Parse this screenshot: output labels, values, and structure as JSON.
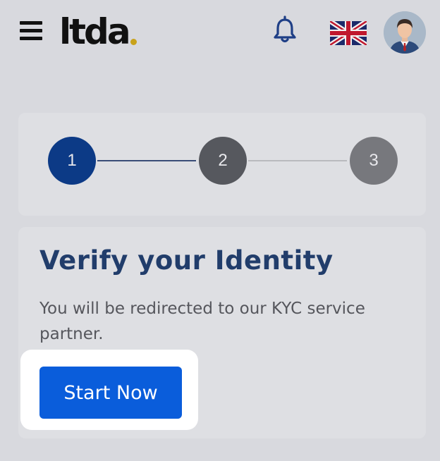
{
  "header": {
    "logo_text": "ltda",
    "icons": {
      "menu": "hamburger-menu-icon",
      "notifications": "bell-icon",
      "language": "uk-flag-icon",
      "profile": "user-avatar"
    }
  },
  "stepper": {
    "steps": [
      {
        "label": "1",
        "state": "active"
      },
      {
        "label": "2",
        "state": "upcoming"
      },
      {
        "label": "3",
        "state": "upcoming"
      }
    ]
  },
  "verify": {
    "title": "Verify your Identity",
    "description": "You will be redirected to our KYC service partner.",
    "button_label": "Start Now"
  },
  "colors": {
    "accent": "#0a5ddb",
    "active_step": "#0c3a86",
    "title": "#213d6b",
    "logo_dot": "#c8a21a"
  }
}
